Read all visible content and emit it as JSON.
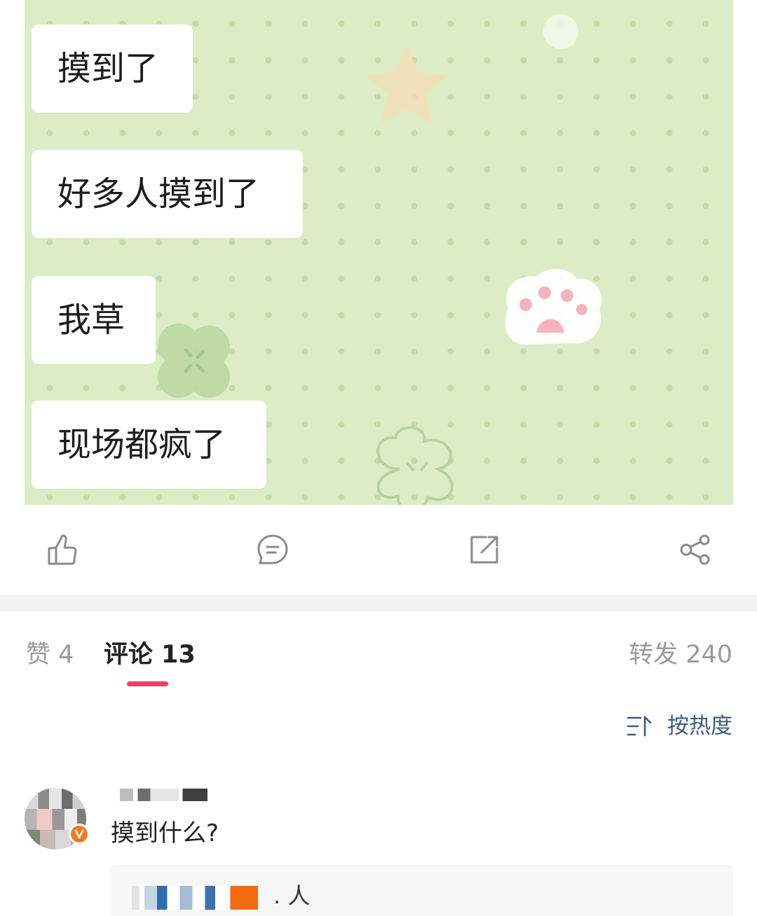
{
  "chat_image": {
    "messages": [
      "摸到了",
      "好多人摸到了",
      "我草",
      "现场都疯了"
    ]
  },
  "action_bar": {
    "icons": [
      "like-icon",
      "comment-icon",
      "repost-icon",
      "share-icon"
    ]
  },
  "tabs": {
    "like_label": "赞 4",
    "comment_label": "评论 13",
    "repost_label": "转发 240",
    "active_indicator_color": "#ef3f5e"
  },
  "sort": {
    "label": "按热度",
    "icon": "sort-icon",
    "color": "#3c5c82"
  },
  "comment": {
    "text": "摸到什么?",
    "badge_color": "#f27b21",
    "reply": {
      "text": ". 人"
    }
  }
}
